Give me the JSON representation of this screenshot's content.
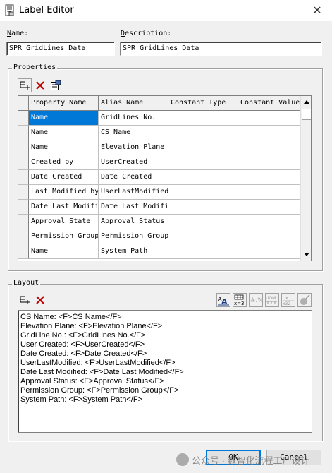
{
  "window": {
    "title": "Label Editor",
    "close_glyph": "✕"
  },
  "name_field": {
    "label_u": "N",
    "label_rest": "ame:",
    "value": "SPR GridLines Data"
  },
  "description_field": {
    "label_u": "D",
    "label_rest": "escription:",
    "value": "SPR GridLines Data"
  },
  "properties": {
    "label": "Properties",
    "columns": [
      "Property Name",
      "Alias Name",
      "Constant Type",
      "Constant Value"
    ],
    "rows": [
      {
        "property": "Name",
        "alias": "GridLines No.",
        "ctype": "",
        "cvalue": ""
      },
      {
        "property": "Name",
        "alias": "CS Name",
        "ctype": "",
        "cvalue": ""
      },
      {
        "property": "Name",
        "alias": "Elevation Plane",
        "ctype": "",
        "cvalue": ""
      },
      {
        "property": "Created by",
        "alias": "UserCreated",
        "ctype": "",
        "cvalue": ""
      },
      {
        "property": "Date Created",
        "alias": "Date Created",
        "ctype": "",
        "cvalue": ""
      },
      {
        "property": "Last Modified by",
        "alias": "UserLastModified",
        "ctype": "",
        "cvalue": ""
      },
      {
        "property": "Date Last Modified",
        "alias": "Date Last Modified",
        "ctype": "",
        "cvalue": ""
      },
      {
        "property": "Approval State",
        "alias": "Approval Status",
        "ctype": "",
        "cvalue": ""
      },
      {
        "property": "Permission Group",
        "alias": "Permission Group",
        "ctype": "",
        "cvalue": ""
      },
      {
        "property": "Name",
        "alias": "System Path",
        "ctype": "",
        "cvalue": ""
      }
    ]
  },
  "layout": {
    "label": "Layout",
    "lines": [
      "CS Name: <F>CS Name</F>",
      "Elevation Plane: <F>Elevation Plane</F>",
      "GridLine No.: <F>GridLines No.</F>",
      "User Created: <F>UserCreated</F>",
      "Date Created: <F>Date Created</F>",
      "UserLastModified: <F>UserLastModified</F>",
      "Date Last Modified: <F>Date Last Modified</F>",
      "Approval Status: <F>Approval Status</F>",
      "Permission Group: <F>Permission Group</F>",
      "System Path: <F>System Path</F>"
    ],
    "format_icons": [
      "font-icon",
      "number-format-icon",
      "hash-format-icon",
      "uom-icon",
      "format-icon",
      "clear-format-icon"
    ]
  },
  "buttons": {
    "ok": "OK",
    "cancel": "Cancel"
  },
  "watermark": {
    "text": "公众号 · 数智化流程工厂设计"
  },
  "colors": {
    "selection": "#0078d7",
    "dialog_bg": "#f0f0f0"
  }
}
